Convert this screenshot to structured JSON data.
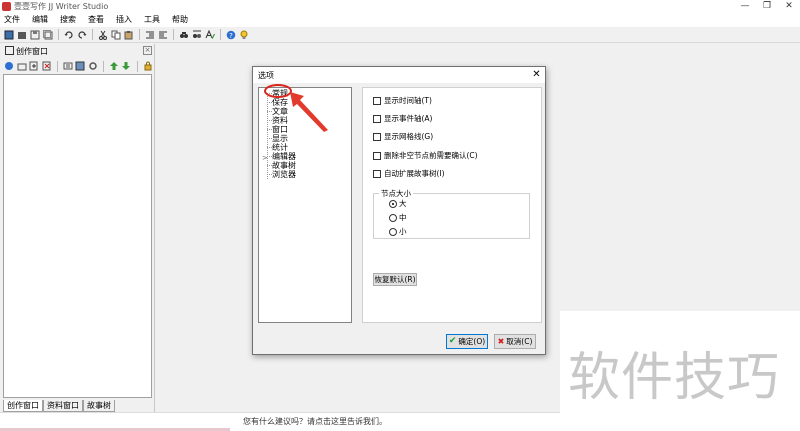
{
  "app": {
    "title": "壹壹写作 JJ Writer Studio",
    "window_controls": {
      "minimize": "—",
      "maximize": "❐",
      "close": "✕"
    }
  },
  "menu": {
    "items": [
      {
        "label": "文件"
      },
      {
        "label": "编辑"
      },
      {
        "label": "搜索"
      },
      {
        "label": "查看"
      },
      {
        "label": "插入"
      },
      {
        "label": "工具"
      },
      {
        "label": "帮助"
      }
    ]
  },
  "left_pane": {
    "title": "创作窗口",
    "close": "×",
    "tabs": [
      {
        "label": "创作窗口"
      },
      {
        "label": "资料窗口"
      },
      {
        "label": "故事树"
      }
    ]
  },
  "dialog": {
    "title": "选项",
    "close": "✕",
    "tree_items": [
      {
        "label": "常规"
      },
      {
        "label": "保存"
      },
      {
        "label": "文章"
      },
      {
        "label": "资料"
      },
      {
        "label": "窗口"
      },
      {
        "label": "显示"
      },
      {
        "label": "统计"
      },
      {
        "label": "编辑器"
      },
      {
        "label": "故事树"
      },
      {
        "label": "浏览器"
      }
    ],
    "tree_expander": ">",
    "checkboxes": [
      {
        "label": "显示时间轴(T)",
        "checked": false
      },
      {
        "label": "显示事件轴(A)",
        "checked": false
      },
      {
        "label": "显示网格线(G)",
        "checked": false
      },
      {
        "label": "删除非空节点前需要确认(C)",
        "checked": false
      },
      {
        "label": "自动扩展故事树(I)",
        "checked": false
      }
    ],
    "node_size": {
      "title": "节点大小",
      "options": [
        {
          "label": "大",
          "selected": true
        },
        {
          "label": "中",
          "selected": false
        },
        {
          "label": "小",
          "selected": false
        }
      ]
    },
    "restore_button": "恢复默认(R)",
    "ok_button": "确定(O)",
    "cancel_button": "取消(C)",
    "ok_icon": "✔",
    "cancel_icon": "✖"
  },
  "status": {
    "text": "您有什么建议吗？请点击这里告诉我们。"
  },
  "watermark": {
    "text": "软件技巧"
  },
  "colors": {
    "highlight": "#d9251a",
    "accent_blue": "#0078d7",
    "ok_check": "#1a9b2e",
    "cancel_x": "#d02020"
  },
  "icons": {
    "toolbar": [
      "new-icon",
      "open-icon",
      "save-icon",
      "save-all-icon",
      "undo-icon",
      "redo-icon",
      "cut-icon",
      "copy-icon",
      "paste-icon",
      "indent-icon",
      "outdent-icon",
      "find-icon",
      "replace-icon",
      "spellcheck-icon",
      "help-icon",
      "tips-icon"
    ]
  }
}
